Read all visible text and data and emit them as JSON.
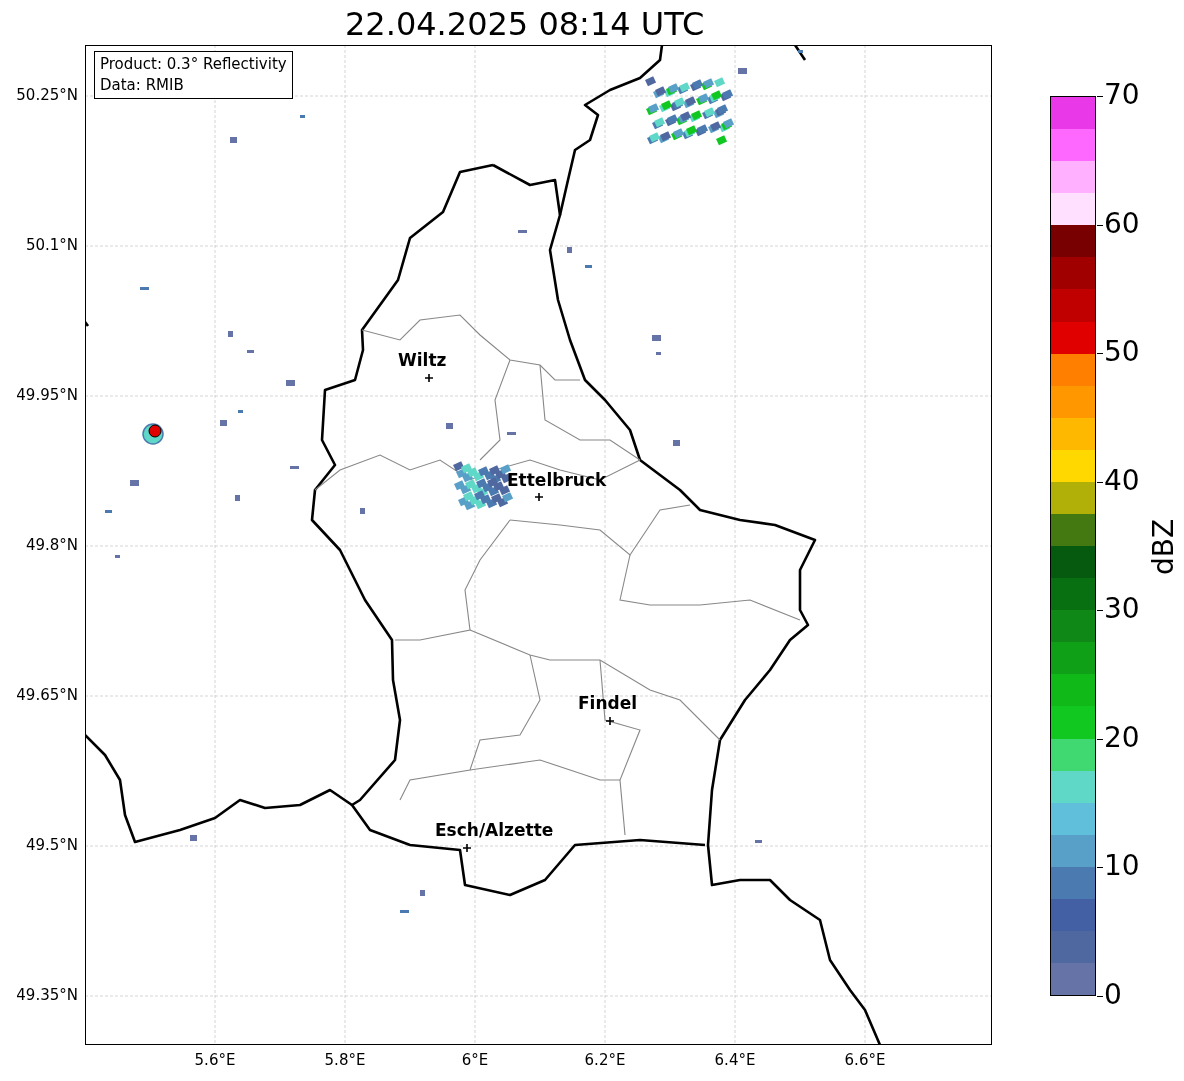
{
  "title": "22.04.2025 08:14 UTC",
  "info_box": [
    "Product: 0.3° Reflectivity",
    "Data: RMIB"
  ],
  "x_ticks": [
    "5.6°E",
    "5.8°E",
    "6°E",
    "6.2°E",
    "6.4°E",
    "6.6°E"
  ],
  "y_ticks": [
    "50.25°N",
    "50.1°N",
    "49.95°N",
    "49.8°N",
    "49.65°N",
    "49.5°N",
    "49.35°N"
  ],
  "cities": [
    {
      "name": "Wiltz"
    },
    {
      "name": "Ettelbruck"
    },
    {
      "name": "Findel"
    },
    {
      "name": "Esch/Alzette"
    }
  ],
  "colorbar": {
    "label": "dBZ",
    "ticks": [
      "70",
      "60",
      "50",
      "40",
      "30",
      "20",
      "10",
      "0"
    ],
    "bins": [
      {
        "color": "#e838e8"
      },
      {
        "color": "#ff68ff"
      },
      {
        "color": "#ffb0ff"
      },
      {
        "color": "#ffe0ff"
      },
      {
        "color": "#780000"
      },
      {
        "color": "#a00000"
      },
      {
        "color": "#c00000"
      },
      {
        "color": "#e00000"
      },
      {
        "color": "#ff8000"
      },
      {
        "color": "#ff9800"
      },
      {
        "color": "#ffb800"
      },
      {
        "color": "#ffd800"
      },
      {
        "color": "#b0b008"
      },
      {
        "color": "#447810"
      },
      {
        "color": "#065a10"
      },
      {
        "color": "#087010"
      },
      {
        "color": "#108818"
      },
      {
        "color": "#10a018"
      },
      {
        "color": "#10b818"
      },
      {
        "color": "#10c820"
      },
      {
        "color": "#40d870"
      },
      {
        "color": "#60d8c8"
      },
      {
        "color": "#60c0dc"
      },
      {
        "color": "#58a0c8"
      },
      {
        "color": "#4a7ab0"
      },
      {
        "color": "#4460a4"
      },
      {
        "color": "#5068a0"
      },
      {
        "color": "#6673a6"
      }
    ]
  }
}
